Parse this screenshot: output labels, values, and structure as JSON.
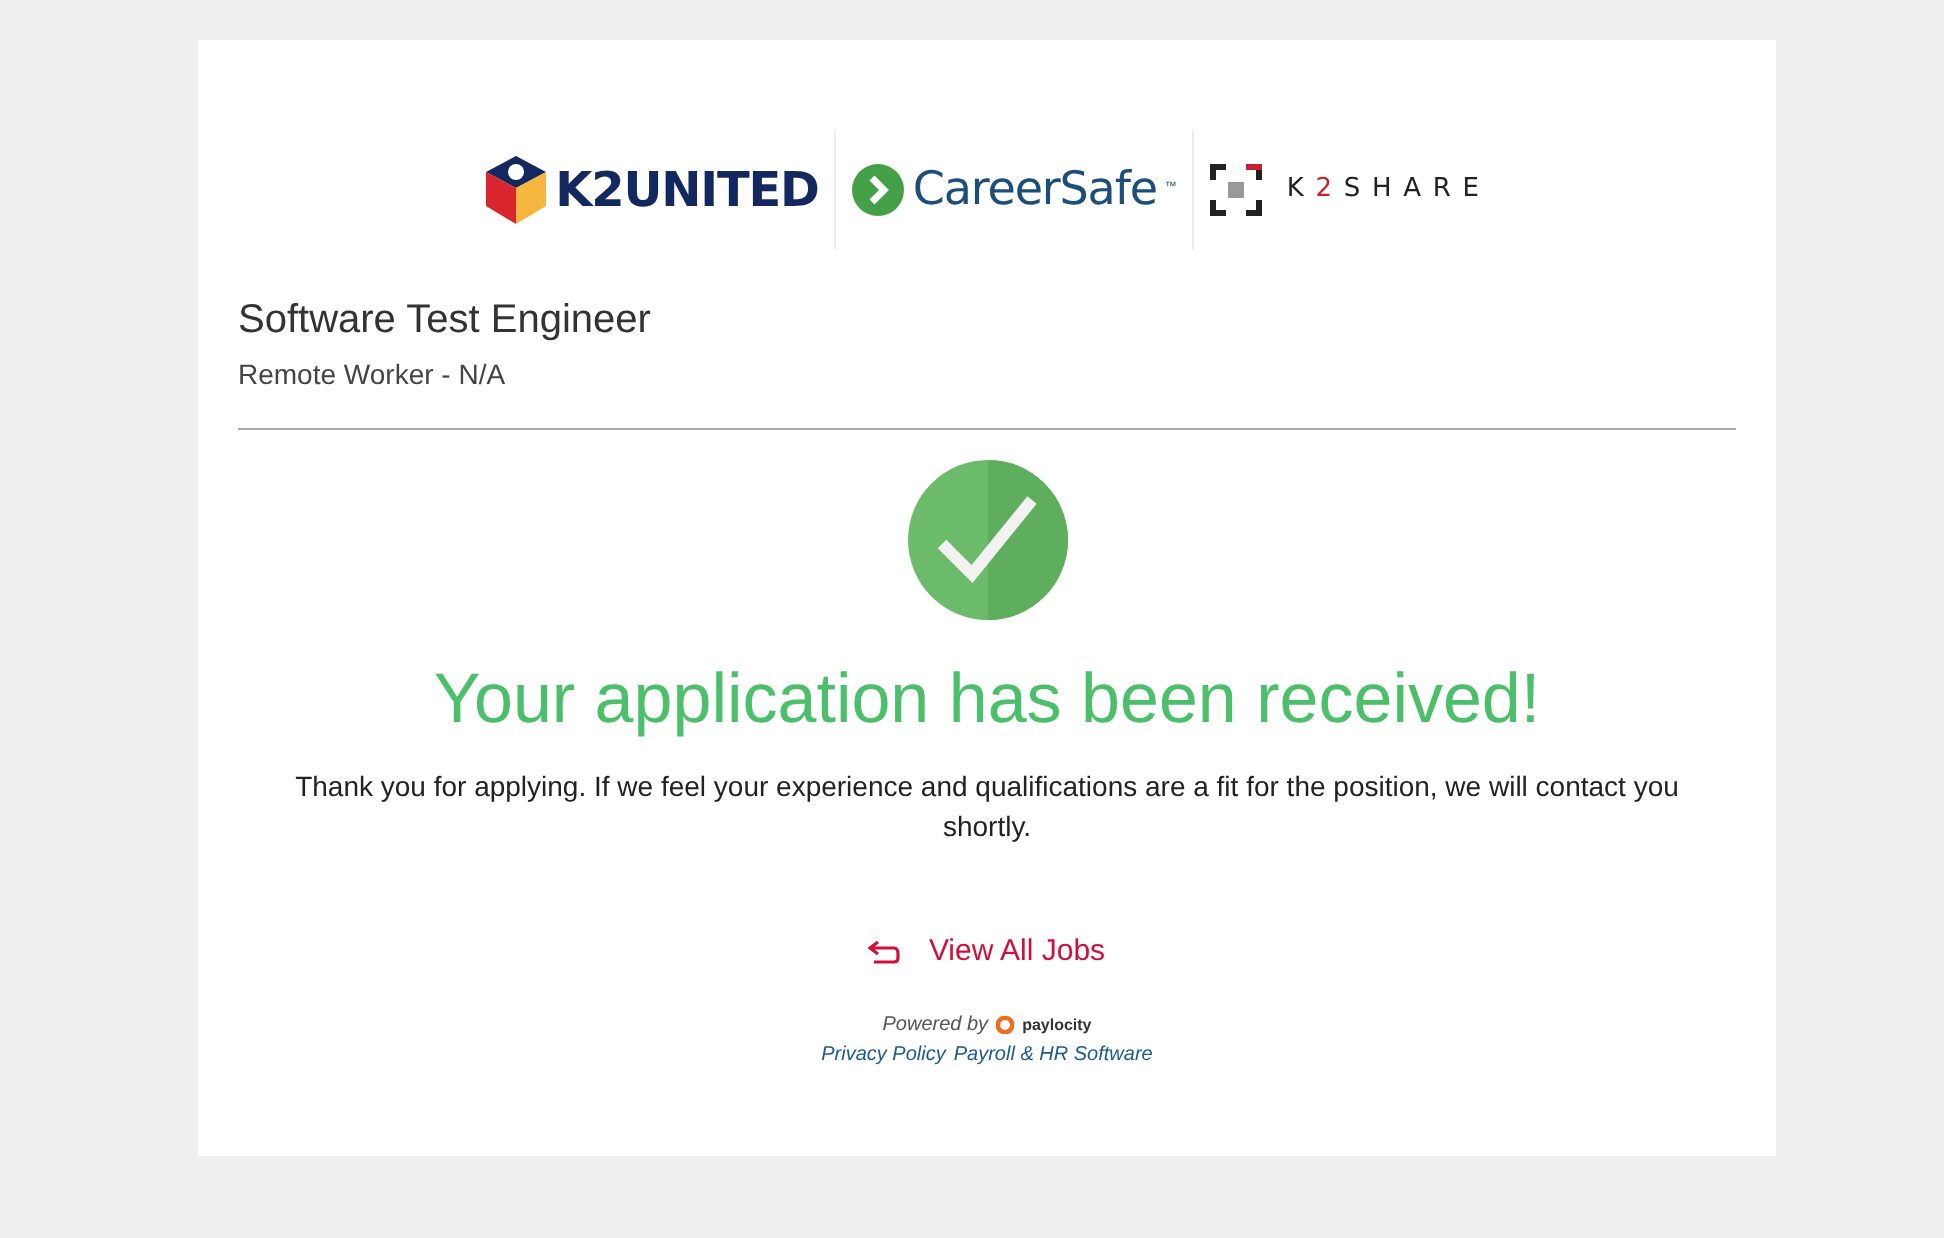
{
  "logos": [
    {
      "kind": "k2united",
      "text": "K2UNITED"
    },
    {
      "kind": "careersafe",
      "text": "CareerSafe",
      "mark": "™"
    },
    {
      "kind": "k2share",
      "prefix": "K",
      "accent": "2",
      "text": "SHARE"
    }
  ],
  "job": {
    "title": "Software Test Engineer",
    "location": "Remote Worker - N/A"
  },
  "confirmation": {
    "heading": "Your application has been received!",
    "message": "Thank you for applying. If we feel your experience and qualifications are a fit for the position, we will contact you shortly."
  },
  "back_link": "View All Jobs",
  "footer": {
    "powered_by": "Powered by",
    "brand": "paylocity",
    "links": [
      "Privacy Policy",
      "Payroll & HR Software"
    ]
  }
}
